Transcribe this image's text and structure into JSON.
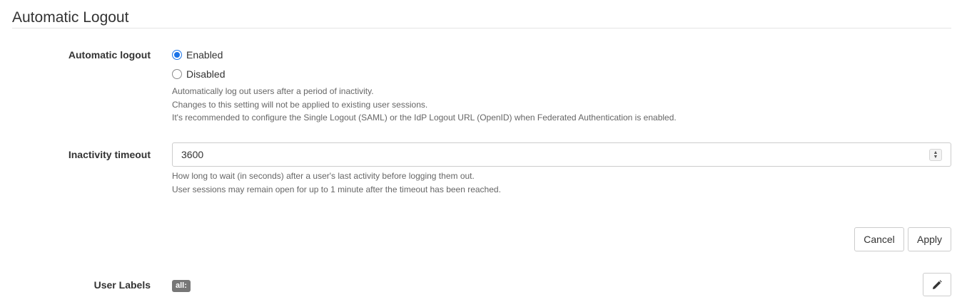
{
  "section": {
    "title": "Automatic Logout"
  },
  "automatic_logout": {
    "label": "Automatic logout",
    "options": [
      {
        "label": "Enabled",
        "checked": true
      },
      {
        "label": "Disabled",
        "checked": false
      }
    ],
    "help": [
      "Automatically log out users after a period of inactivity.",
      "Changes to this setting will not be applied to existing user sessions.",
      "It's recommended to configure the Single Logout (SAML) or the IdP Logout URL (OpenID) when Federated Authentication is enabled."
    ]
  },
  "inactivity_timeout": {
    "label": "Inactivity timeout",
    "value": "3600",
    "help": [
      "How long to wait (in seconds) after a user's last activity before logging them out.",
      "User sessions may remain open for up to 1 minute after the timeout has been reached."
    ]
  },
  "actions": {
    "cancel_label": "Cancel",
    "apply_label": "Apply"
  },
  "user_labels": {
    "label": "User Labels",
    "badge": "all:",
    "edit_icon": "pencil-icon"
  },
  "colors": {
    "accent": "#1a73e8",
    "badge_bg": "#777777",
    "border": "#cccccc",
    "help_text": "#666666"
  }
}
